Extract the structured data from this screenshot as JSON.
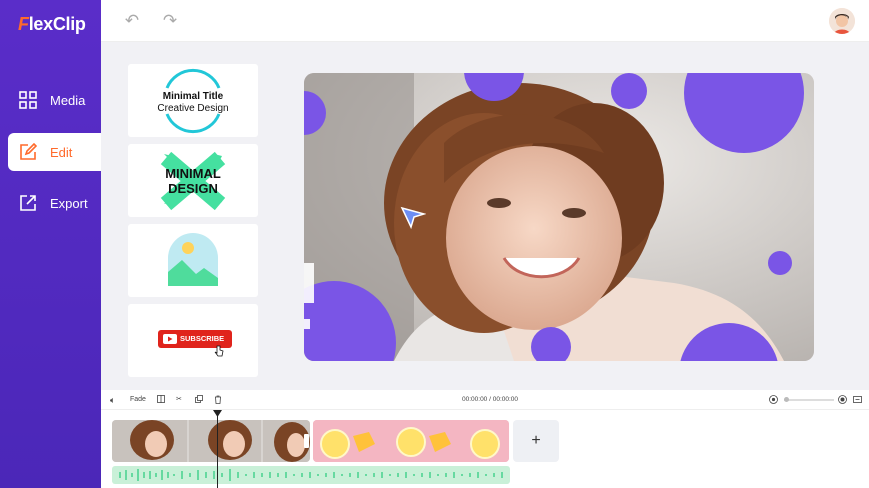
{
  "app": {
    "logo_mark": "F",
    "logo_text": "lexClip"
  },
  "sidebar": {
    "items": [
      {
        "label": "Media",
        "icon": "grid-icon"
      },
      {
        "label": "Edit",
        "icon": "edit-icon"
      },
      {
        "label": "Export",
        "icon": "export-icon"
      }
    ],
    "active": "Edit"
  },
  "templates": [
    {
      "line1": "Minimal Title",
      "line2": "Creative Design"
    },
    {
      "line1": "MINIMAL",
      "line2": "DESIGN"
    },
    {
      "name": "image-placeholder-icon"
    },
    {
      "label": "SUBSCRIBE"
    }
  ],
  "toolbar": {
    "fade_label": "Fade",
    "time": "00:00:00 / 00:00:00"
  },
  "timeline": {
    "add_label": "+"
  },
  "colors": {
    "sidebar": "#5a2dc9",
    "accent": "#ff6a2b",
    "circle": "#7a55e6",
    "mint": "#45e0a0",
    "subscribe": "#e0241c"
  }
}
